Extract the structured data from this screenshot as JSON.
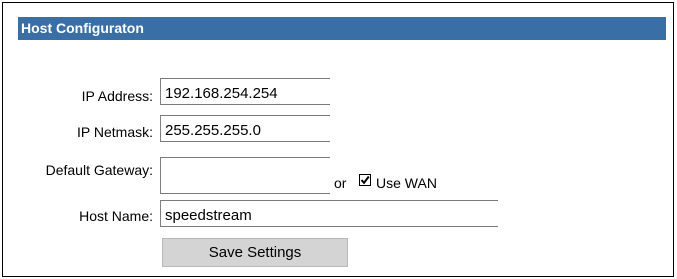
{
  "header": {
    "title": "Host Configuraton"
  },
  "fields": {
    "ip_address": {
      "label": "IP Address:",
      "value": "192.168.254.254"
    },
    "ip_netmask": {
      "label": "IP Netmask:",
      "value": "255.255.255.0"
    },
    "default_gateway": {
      "label": "Default Gateway:",
      "value": "",
      "or_text": "or",
      "use_wan_label": "Use WAN",
      "use_wan_checked": true
    },
    "host_name": {
      "label": "Host Name:",
      "value": "speedstream"
    }
  },
  "actions": {
    "save_label": "Save Settings"
  },
  "colors": {
    "header_bg": "#3a6fa6",
    "header_text": "#ffffff",
    "button_bg": "#d4d4d4"
  }
}
